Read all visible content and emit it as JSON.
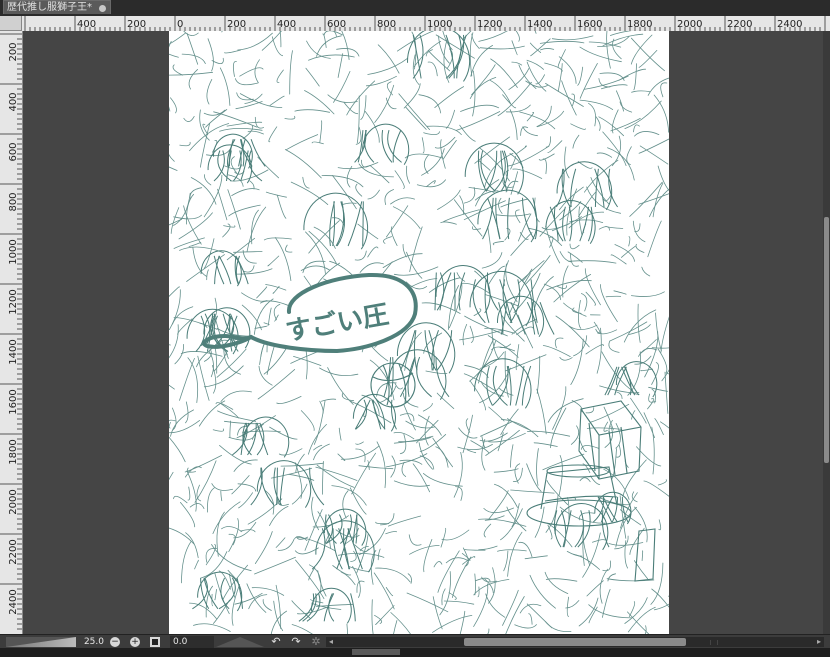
{
  "document": {
    "tab_title": "歴代推し服獅子王*"
  },
  "rulers": {
    "horizontal_labels": [
      "400",
      "200",
      "0",
      "200",
      "400",
      "600",
      "800",
      "1000",
      "1200",
      "1400",
      "1600",
      "1800",
      "2000",
      "2200",
      "2400"
    ],
    "vertical_labels": [
      "200",
      "400",
      "600",
      "800",
      "1000",
      "1200",
      "1400",
      "1600",
      "1800",
      "2000",
      "2200",
      "2400"
    ]
  },
  "canvas": {
    "speech_bubble_text": "すごい圧",
    "line_color": "#4a7d78",
    "paper_color": "#ffffff"
  },
  "statusbar": {
    "zoom_value": "25.0",
    "zoom_out_symbol": "−",
    "zoom_in_symbol": "+",
    "rotation_value": "0.0",
    "rotate_left_symbol": "↶",
    "rotate_right_symbol": "↷",
    "reset_rotation_symbol": "✲",
    "scroll_left_symbol": "◂",
    "scroll_right_symbol": "▸"
  },
  "icons": {
    "tab_close": "close-dot-icon",
    "zoom_out": "zoom-out-icon",
    "zoom_in": "zoom-in-icon",
    "fit": "fit-to-window-icon",
    "rotate_left": "rotate-left-icon",
    "rotate_right": "rotate-right-icon",
    "reset_rotation": "reset-rotation-icon"
  },
  "colors": {
    "workspace": "#454545",
    "ruler": "#e6e6e6",
    "toolbar": "#3c3c3c"
  }
}
